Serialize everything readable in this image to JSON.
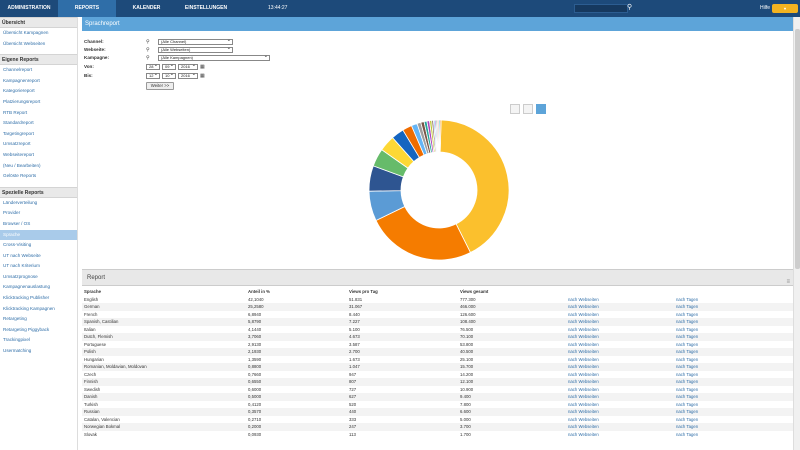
{
  "topbar": {
    "tabs": [
      "ADMINISTRATION",
      "REPORTS",
      "KALENDER",
      "EINSTELLUNGEN"
    ],
    "clock": "13:44:27",
    "help": "Hilfe"
  },
  "sidebar": {
    "sections": [
      {
        "title": "Übersicht",
        "items": [
          "Übersicht Kampagnen",
          "Übersicht Webseiten"
        ]
      },
      {
        "title": "Eigene Reports",
        "items": [
          "Channelreport",
          "Kampagnenreport",
          "Kategoriereport",
          "Platzierungsreport",
          "RTB Report",
          "Standardreport",
          "Targetingreport",
          "Umsatzreport",
          "Webseitereport",
          "(Neu / Bearbeiten)",
          "Gelöste Reports"
        ]
      },
      {
        "title": "Spezielle Reports",
        "items": [
          "Länderverteilung",
          "Provider",
          "Browser / OS",
          "Sprache",
          "Cross-Visiting",
          "UT nach Webseite",
          "UT nach Kriterium",
          "Umsatzprognose",
          "Kampagnenauslastung",
          "Klicktracking Publisher",
          "Klicktracking Kampagnen",
          "Retargeting",
          "Retargeting Piggyback",
          "Trackingpixel",
          "Usermatching"
        ]
      }
    ],
    "active_item": "Sprache"
  },
  "main": {
    "title": "Sprachreport",
    "filters": {
      "channel_label": "Channel:",
      "channel_value": "(Alle Channel)",
      "website_label": "Webseite:",
      "website_value": "(Alle Webseiten)",
      "campaign_label": "Kampagne:",
      "campaign_value": "(Alle Kampagnen)",
      "from_label": "Von:",
      "from_day": "28",
      "from_month": "09",
      "from_year": "2016",
      "to_label": "Bis:",
      "to_day": "12",
      "to_month": "10",
      "to_year": "2016",
      "submit": "Weiter >>"
    }
  },
  "chart_data": {
    "type": "pie",
    "donut": true,
    "categories": [
      "English",
      "German",
      "French",
      "Spanish, Castilian",
      "Italian",
      "Dutch, Flemish",
      "Portuguese",
      "Polish",
      "Hungarian",
      "Romanian, Moldavian, Moldovan",
      "Czech",
      "Finnish",
      "Swedish",
      "Danish",
      "Turkish",
      "Russian"
    ],
    "values": [
      42.104,
      25.258,
      6.894,
      5.879,
      4.144,
      3.706,
      2.913,
      2.193,
      1.359,
      0.88,
      0.766,
      0.655,
      0.6,
      0.5,
      0.412,
      0.357
    ],
    "colors": [
      "#fbc02d",
      "#f57c00",
      "#5b9bd5",
      "#2e5591",
      "#66bb6a",
      "#fdd835",
      "#1565c0",
      "#ef6c00",
      "#64b5f6",
      "#9e9e9e",
      "#795548",
      "#26a69a",
      "#ab47bc",
      "#c0ca33",
      "#8d6e63",
      "#90caf9"
    ]
  },
  "report": {
    "title": "Report",
    "columns": [
      "Sprache",
      "Anteil in %",
      "Views pro Tag",
      "Views gesamt",
      "",
      ""
    ],
    "link_webseiten": "nach Webseiten",
    "link_tagen": "nach Tagen",
    "rows": [
      [
        "English",
        "42,1040",
        "51.831",
        "777.300"
      ],
      [
        "German",
        "25,2580",
        "31.067",
        "466.000"
      ],
      [
        "French",
        "6,8940",
        "8.440",
        "126.600"
      ],
      [
        "Spanish, Castilian",
        "5,8790",
        "7.227",
        "108.400"
      ],
      [
        "Italian",
        "4,1440",
        "5.100",
        "76.500"
      ],
      [
        "Dutch, Flemish",
        "3,7060",
        "4.673",
        "70.100"
      ],
      [
        "Portuguese",
        "2,9130",
        "3.587",
        "53.800"
      ],
      [
        "Polish",
        "2,1930",
        "2.700",
        "40.500"
      ],
      [
        "Hungarian",
        "1,3590",
        "1.673",
        "25.100"
      ],
      [
        "Romanian, Moldavian, Moldovan",
        "0,8800",
        "1.047",
        "15.700"
      ],
      [
        "Czech",
        "0,7660",
        "947",
        "14.200"
      ],
      [
        "Finnish",
        "0,6550",
        "807",
        "12.100"
      ],
      [
        "Swedish",
        "0,6000",
        "727",
        "10.900"
      ],
      [
        "Danish",
        "0,5000",
        "627",
        "9.400"
      ],
      [
        "Turkish",
        "0,4120",
        "520",
        "7.800"
      ],
      [
        "Russian",
        "0,3570",
        "440",
        "6.600"
      ],
      [
        "Catalan, Valencian",
        "0,2710",
        "333",
        "5.000"
      ],
      [
        "Norwegian Bokmal",
        "0,2000",
        "247",
        "3.700"
      ],
      [
        "Slovak",
        "0,0930",
        "113",
        "1.700"
      ]
    ]
  }
}
